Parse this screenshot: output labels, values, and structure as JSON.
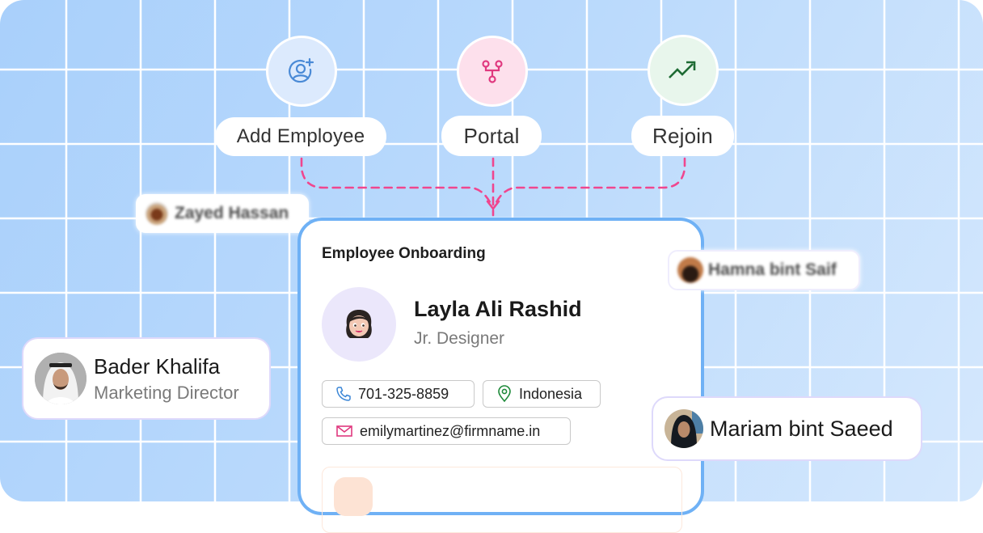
{
  "flow": {
    "nodes": [
      {
        "label": "Add Employee",
        "icon": "user-add-icon",
        "bg": "#dceafd",
        "icon_color": "#4a8ad6"
      },
      {
        "label": "Portal",
        "icon": "fork-icon",
        "bg": "#fde0ec",
        "icon_color": "#e0397f"
      },
      {
        "label": "Rejoin",
        "icon": "trending-up-icon",
        "bg": "#e6f5ea",
        "icon_color": "#1e6b34"
      }
    ],
    "connector_color": "#f0468e"
  },
  "card": {
    "title": "Employee Onboarding",
    "employee": {
      "name": "Layla Ali Rashid",
      "role": "Jr. Designer",
      "avatar": "woman-emoji-avatar"
    },
    "chips": {
      "phone": {
        "value": "701-325-8859",
        "icon": "phone-icon",
        "icon_color": "#3b86d6"
      },
      "location": {
        "value": "Indonesia",
        "icon": "location-pin-icon",
        "icon_color": "#1e8a3a"
      },
      "email": {
        "value": "emilymartinez@firmname.in",
        "icon": "mail-icon",
        "icon_color": "#e0397f"
      }
    },
    "border_color": "#6fb1f5"
  },
  "people": {
    "zayed": {
      "name": "Zayed Hassan"
    },
    "hamna": {
      "name": "Hamna bint Saif"
    },
    "bader": {
      "name": "Bader Khalifa",
      "role": "Marketing Director"
    },
    "mariam": {
      "name": "Mariam bint Saeed"
    }
  }
}
